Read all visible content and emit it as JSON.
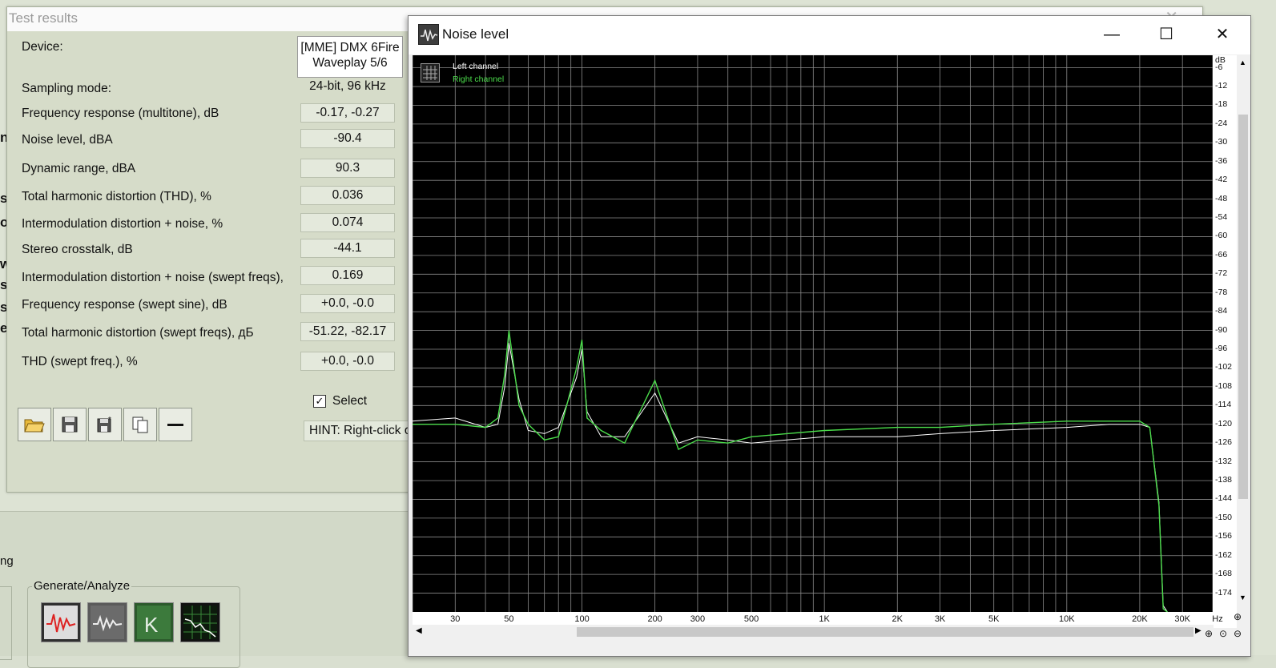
{
  "background": {
    "left_fragment": "ng",
    "left_glyphs": [
      "ns",
      "s",
      "o",
      "w",
      "s",
      "s",
      "es"
    ],
    "generate_group_label": "Generate/Analyze",
    "generate_buttons": [
      "red-waveform",
      "gray-waveform",
      "green-logo",
      "green-chart"
    ]
  },
  "test_results": {
    "title": "Test results",
    "device_label": "Device:",
    "device_value_line1": "[MME] DMX 6Fire",
    "device_value_line2": "Waveplay 5/6",
    "rows": [
      {
        "label": "Sampling mode:",
        "value": "24-bit, 96 kHz",
        "boxed": false
      },
      {
        "label": "Frequency response (multitone), dB",
        "value": "-0.17, -0.27",
        "boxed": true
      },
      {
        "label": "Noise level, dBA",
        "value": "-90.4",
        "boxed": true
      },
      {
        "label": "Dynamic range, dBA",
        "value": "90.3",
        "boxed": true
      },
      {
        "label": "Total harmonic distortion (THD), %",
        "value": "0.036",
        "boxed": true
      },
      {
        "label": "Intermodulation distortion + noise, %",
        "value": "0.074",
        "boxed": true
      },
      {
        "label": "Stereo crosstalk, dB",
        "value": "-44.1",
        "boxed": true
      },
      {
        "label": "Intermodulation distortion + noise (swept freqs),",
        "value": "0.169",
        "boxed": true
      },
      {
        "label": "Frequency response (swept sine), dB",
        "value": "+0.0, -0.0",
        "boxed": true
      },
      {
        "label": "Total harmonic distortion (swept freqs), дБ",
        "value": "-51.22, -82.17",
        "boxed": true
      },
      {
        "label": "THD (swept freq.), %",
        "value": "+0.0, -0.0",
        "boxed": true
      }
    ],
    "select_label": "Select",
    "select_checked": true,
    "hint": "HINT: Right-click o",
    "toolbar": [
      "open-folder",
      "save",
      "save-as",
      "copy",
      "minus"
    ]
  },
  "noise_window": {
    "title": "Noise level",
    "legend_left": "Left channel",
    "legend_right": "Right channel",
    "colors": {
      "left": "#ffffff",
      "right": "#4bdc4b",
      "grid": "#8a8a8a",
      "background": "#000000"
    },
    "y_unit": "dB",
    "x_unit": "Hz"
  },
  "chart_data": {
    "type": "line",
    "title": "",
    "xlabel": "Hz",
    "ylabel": "dB",
    "x_scale": "log",
    "xlim": [
      20,
      40000
    ],
    "ylim": [
      -180,
      -2
    ],
    "x_tick_labels": [
      "30",
      "50",
      "100",
      "200",
      "300",
      "500",
      "1K",
      "2K",
      "3K",
      "5K",
      "10K",
      "20K",
      "30K"
    ],
    "x_ticks": [
      30,
      50,
      100,
      200,
      300,
      500,
      1000,
      2000,
      3000,
      5000,
      10000,
      20000,
      30000
    ],
    "y_ticks": [
      -6,
      -12,
      -18,
      -24,
      -30,
      -36,
      -42,
      -48,
      -54,
      -60,
      -66,
      -72,
      -78,
      -84,
      -90,
      -96,
      -102,
      -108,
      -114,
      -120,
      -126,
      -132,
      -138,
      -144,
      -150,
      -156,
      -162,
      -168,
      -174
    ],
    "grid": true,
    "legend": "top-left",
    "series": [
      {
        "name": "Left channel",
        "x": [
          20,
          30,
          40,
          45,
          48,
          50,
          55,
          60,
          70,
          80,
          95,
          100,
          105,
          120,
          150,
          200,
          250,
          300,
          400,
          500,
          700,
          1000,
          2000,
          3000,
          5000,
          10000,
          15000,
          20000,
          22000,
          24000,
          25000,
          26000
        ],
        "values": [
          -119,
          -118,
          -121,
          -120,
          -108,
          -94,
          -112,
          -122,
          -123,
          -121,
          -105,
          -96,
          -116,
          -124,
          -124,
          -110,
          -126,
          -124,
          -125,
          -126,
          -125,
          -124,
          -124,
          -123,
          -122,
          -121,
          -120,
          -120,
          -121,
          -145,
          -178,
          -180
        ]
      },
      {
        "name": "Right channel",
        "x": [
          20,
          30,
          40,
          45,
          48,
          50,
          55,
          60,
          70,
          80,
          95,
          100,
          105,
          120,
          150,
          200,
          250,
          300,
          400,
          500,
          700,
          1000,
          2000,
          3000,
          5000,
          10000,
          15000,
          20000,
          22000,
          24000,
          25000,
          26000
        ],
        "values": [
          -120,
          -120,
          -121,
          -118,
          -104,
          -90,
          -114,
          -120,
          -125,
          -124,
          -102,
          -93,
          -118,
          -122,
          -126,
          -106,
          -128,
          -125,
          -126,
          -124,
          -123,
          -122,
          -121,
          -121,
          -120,
          -119,
          -119,
          -119,
          -121,
          -146,
          -179,
          -180
        ]
      }
    ]
  }
}
